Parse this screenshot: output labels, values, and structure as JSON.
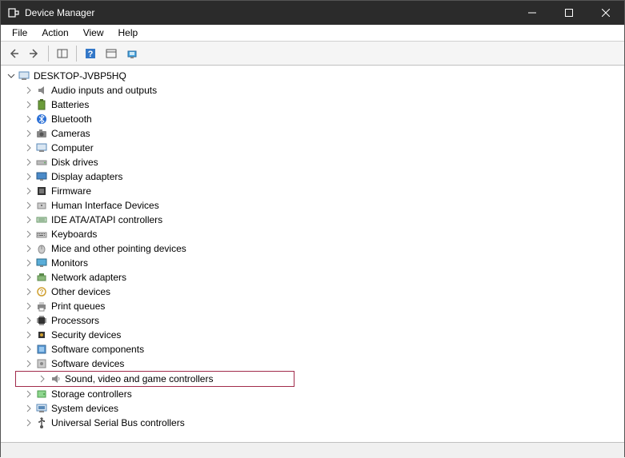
{
  "window": {
    "title": "Device Manager"
  },
  "menu": {
    "file": "File",
    "action": "Action",
    "view": "View",
    "help": "Help"
  },
  "tree": {
    "root": "DESKTOP-JVBP5HQ",
    "categories": [
      {
        "label": "Audio inputs and outputs",
        "icon": "speaker"
      },
      {
        "label": "Batteries",
        "icon": "battery"
      },
      {
        "label": "Bluetooth",
        "icon": "bluetooth"
      },
      {
        "label": "Cameras",
        "icon": "camera"
      },
      {
        "label": "Computer",
        "icon": "computer"
      },
      {
        "label": "Disk drives",
        "icon": "disk"
      },
      {
        "label": "Display adapters",
        "icon": "display"
      },
      {
        "label": "Firmware",
        "icon": "firmware"
      },
      {
        "label": "Human Interface Devices",
        "icon": "hid"
      },
      {
        "label": "IDE ATA/ATAPI controllers",
        "icon": "ide"
      },
      {
        "label": "Keyboards",
        "icon": "keyboard"
      },
      {
        "label": "Mice and other pointing devices",
        "icon": "mouse"
      },
      {
        "label": "Monitors",
        "icon": "monitor"
      },
      {
        "label": "Network adapters",
        "icon": "network"
      },
      {
        "label": "Other devices",
        "icon": "other"
      },
      {
        "label": "Print queues",
        "icon": "printer"
      },
      {
        "label": "Processors",
        "icon": "processor"
      },
      {
        "label": "Security devices",
        "icon": "security"
      },
      {
        "label": "Software components",
        "icon": "softcomp"
      },
      {
        "label": "Software devices",
        "icon": "softdev"
      },
      {
        "label": "Sound, video and game controllers",
        "icon": "sound",
        "highlighted": true
      },
      {
        "label": "Storage controllers",
        "icon": "storage"
      },
      {
        "label": "System devices",
        "icon": "system"
      },
      {
        "label": "Universal Serial Bus controllers",
        "icon": "usb"
      }
    ]
  }
}
